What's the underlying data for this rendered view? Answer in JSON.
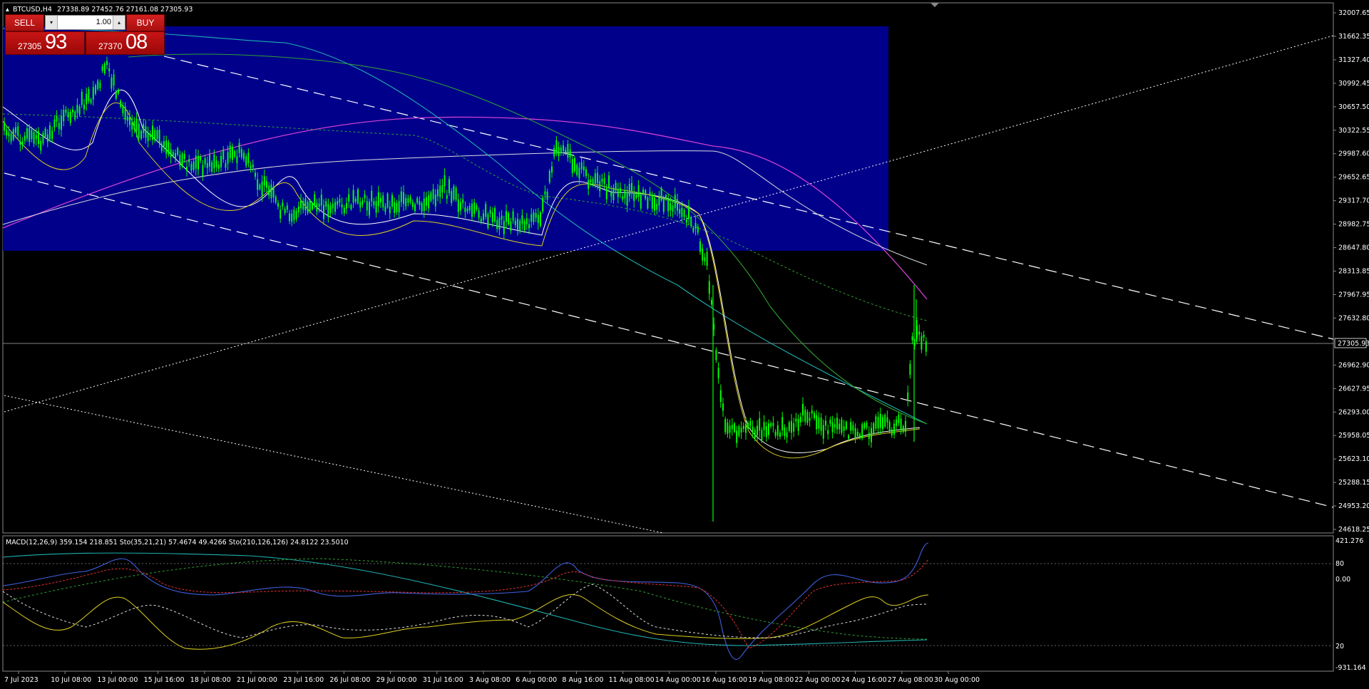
{
  "chart_header": {
    "symbol": "BTCUSD,H4",
    "ohlc": "27338.89 27452.76 27161.08 27305.93"
  },
  "trade_panel": {
    "sell_label": "SELL",
    "buy_label": "BUY",
    "lot_value": "1.00",
    "sell_price_small": "27305",
    "sell_price_big": "93",
    "buy_price_small": "27370",
    "buy_price_big": "08"
  },
  "current_price_label": "27305.93",
  "price_axis": [
    "32007.65",
    "31662.35",
    "31327.40",
    "30992.45",
    "30657.50",
    "30322.55",
    "29987.60",
    "29652.65",
    "29317.70",
    "28982.75",
    "28647.80",
    "28313.85",
    "27967.95",
    "27632.80",
    "26962.90",
    "26627.95",
    "26293.00",
    "25958.05",
    "25623.10",
    "25288.15",
    "24953.20",
    "24618.25"
  ],
  "indicator_header": "MACD(12,26,9) 359.154 218.851  Sto(35,21,21) 57.4674 49.4266  Sto(210,126,126) 24.8122 23.5010",
  "indicator_axis": [
    "421.276",
    "80",
    "0.00",
    "20",
    "-931.164"
  ],
  "time_axis": [
    "7 Jul 2023",
    "10 Jul 08:00",
    "13 Jul 00:00",
    "15 Jul 16:00",
    "18 Jul 08:00",
    "21 Jul 00:00",
    "23 Jul 16:00",
    "26 Jul 08:00",
    "29 Jul 00:00",
    "31 Jul 16:00",
    "3 Aug 08:00",
    "6 Aug 00:00",
    "8 Aug 16:00",
    "11 Aug 08:00",
    "14 Aug 00:00",
    "16 Aug 16:00",
    "19 Aug 08:00",
    "22 Aug 00:00",
    "24 Aug 16:00",
    "27 Aug 08:00",
    "30 Aug 00:00"
  ],
  "colors": {
    "background": "#000000",
    "zone": "#00008b",
    "candles": "#00ff00",
    "magenta_ma": "#d040d0",
    "teal_ma": "#20b0b0",
    "green_ma": "#30a030",
    "axis_text": "#ffffff",
    "trade_red": "#c81515"
  }
}
